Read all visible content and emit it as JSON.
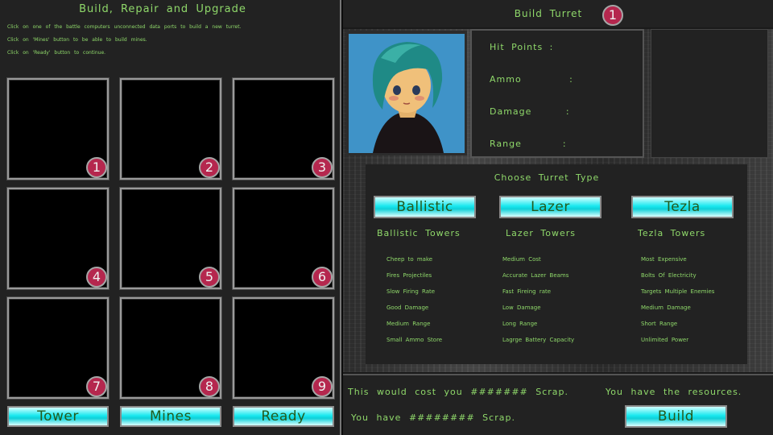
{
  "left": {
    "title": "Build, Repair and Upgrade",
    "instructions": [
      "Click on one of  the battle computers unconnected data ports to build  a new turret.",
      "Click on 'Mines' button to be able to build mines.",
      "Click on 'Ready' button to continue."
    ],
    "slots": [
      "1",
      "2",
      "3",
      "4",
      "5",
      "6",
      "7",
      "8",
      "9"
    ],
    "buttons": {
      "tower": "Tower",
      "mines": "Mines",
      "ready": "Ready"
    }
  },
  "right": {
    "title": "Build Turret",
    "slot_number": "1",
    "stats": {
      "hit_points": "Hit Points :",
      "ammo": "Ammo       :",
      "damage": "Damage     :",
      "range": "Range      :"
    },
    "choose_title": "Choose Turret Type",
    "types": [
      {
        "button": "Ballistic",
        "heading": "Ballistic Towers",
        "features": [
          "Cheep to make",
          "Fires Projectiles",
          "Slow Firing Rate",
          "Good Damage",
          "Medium Range",
          "Small Ammo Store"
        ]
      },
      {
        "button": "Lazer",
        "heading": "Lazer Towers",
        "features": [
          "Medium Cost",
          "Accurate Lazer Beams",
          "Fast Fireing rate",
          "Low Damage",
          "Long Range",
          "Lagrge Battery Capacity"
        ]
      },
      {
        "button": "Tezla",
        "heading": "Tezla Towers",
        "features": [
          "Most Expensive",
          "Bolts Of Electricity",
          "Targets Multiple Enemies",
          "Medium Damage",
          "Short Range",
          "Unlimited Power"
        ]
      }
    ],
    "cost_text": "This would cost you ####### Scrap.",
    "have_text": "You have ######## Scrap.",
    "resources_text": "You have the resources.",
    "build_button": "Build"
  },
  "colors": {
    "badge": "#b5274e",
    "text": "#8fd86a",
    "button": "#19e8ef",
    "button_text": "#235a1c"
  },
  "icons": {
    "portrait": "character-portrait"
  }
}
